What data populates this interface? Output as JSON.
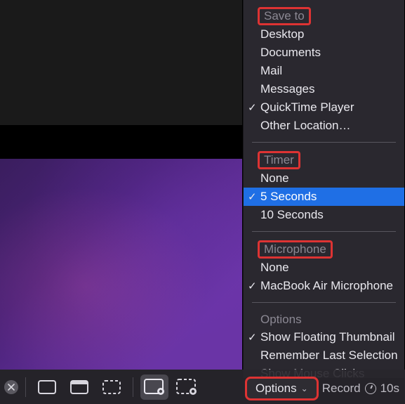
{
  "menu": {
    "save_to": {
      "title": "Save to",
      "items": [
        {
          "label": "Desktop",
          "checked": false
        },
        {
          "label": "Documents",
          "checked": false
        },
        {
          "label": "Mail",
          "checked": false
        },
        {
          "label": "Messages",
          "checked": false
        },
        {
          "label": "QuickTime Player",
          "checked": true
        },
        {
          "label": "Other Location…",
          "checked": false
        }
      ]
    },
    "timer": {
      "title": "Timer",
      "items": [
        {
          "label": "None",
          "checked": false
        },
        {
          "label": "5 Seconds",
          "checked": true,
          "selected": true
        },
        {
          "label": "10 Seconds",
          "checked": false
        }
      ]
    },
    "microphone": {
      "title": "Microphone",
      "items": [
        {
          "label": "None",
          "checked": false
        },
        {
          "label": "MacBook Air Microphone",
          "checked": true
        }
      ]
    },
    "options": {
      "title": "Options",
      "items": [
        {
          "label": "Show Floating Thumbnail",
          "checked": true
        },
        {
          "label": "Remember Last Selection",
          "checked": false
        },
        {
          "label": "Show Mouse Clicks",
          "checked": false
        }
      ]
    }
  },
  "toolbar": {
    "options_label": "Options",
    "record_label": "Record",
    "timer_badge": "10s"
  },
  "highlight_boxes": [
    "save_to",
    "timer",
    "microphone",
    "options_pill"
  ]
}
